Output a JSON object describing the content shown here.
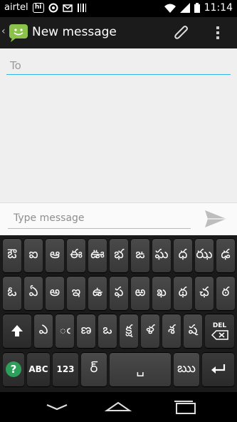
{
  "status_bar": {
    "carrier": "airtel",
    "time": "11:14",
    "badge_text": "hi"
  },
  "action_bar": {
    "title": "New message"
  },
  "compose": {
    "to_placeholder": "To",
    "message_placeholder": "Type message"
  },
  "keyboard": {
    "row1": [
      "ఔ",
      "ఐ",
      "ఆ",
      "ఈ",
      "ఊ",
      "భ",
      "ఙ",
      "ఘ",
      "ధ",
      "ఝ",
      "ఢ"
    ],
    "row2": [
      "ఓ",
      "ఏ",
      "అ",
      "ఇ",
      "ఉ",
      "ఫ",
      "ఱ",
      "ఖ",
      "థ",
      "ఛ",
      "ఠ"
    ],
    "row3": [
      "ఎ",
      "◌ఁ",
      "ణ",
      "ఒ",
      "క్ష",
      "ళ",
      "శ",
      "ష"
    ],
    "delete_label": "DEL",
    "abc_label": "ABC",
    "num_label": "123",
    "special_key": "ర్",
    "space_label": "␣",
    "right_key": "ఋ"
  },
  "colors": {
    "accent": "#33b5e5",
    "app_icon": "#8bc34a",
    "mic_key": "#2e9e5b"
  }
}
